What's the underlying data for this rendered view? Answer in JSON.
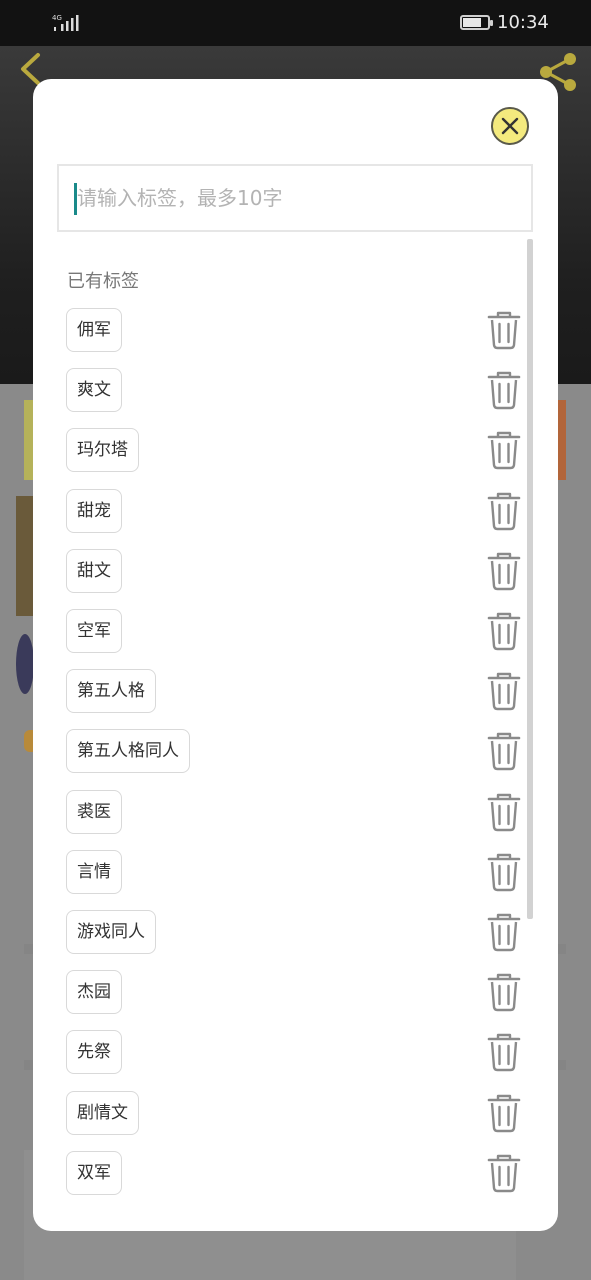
{
  "status_bar": {
    "network": "4G",
    "battery_level": 0.75,
    "time": "10:34"
  },
  "header": {
    "back_icon": "back-arrow-icon",
    "share_icon": "share-icon"
  },
  "dialog": {
    "close_icon": "close-icon",
    "tag_input": {
      "placeholder": "请输入标签，最多10字",
      "value": ""
    },
    "section_label": "已有标签",
    "tags": [
      {
        "label": "佣军"
      },
      {
        "label": "爽文"
      },
      {
        "label": "玛尔塔"
      },
      {
        "label": "甜宠"
      },
      {
        "label": "甜文"
      },
      {
        "label": "空军"
      },
      {
        "label": "第五人格"
      },
      {
        "label": "第五人格同人"
      },
      {
        "label": "裘医"
      },
      {
        "label": "言情"
      },
      {
        "label": "游戏同人"
      },
      {
        "label": "杰园"
      },
      {
        "label": "先祭"
      },
      {
        "label": "剧情文"
      },
      {
        "label": "双军"
      }
    ],
    "delete_icon": "trash-icon"
  },
  "colors": {
    "accent_yellow": "#f4ea7e",
    "caret_teal": "#1a8a8a",
    "back_arrow": "#d6c24a"
  }
}
